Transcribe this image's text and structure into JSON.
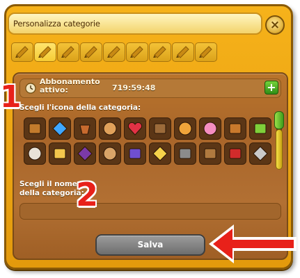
{
  "dialog": {
    "title": "Personalizza categorie",
    "close_label": "×"
  },
  "category_slots": {
    "count": 9,
    "selected_index": 1,
    "icon": "pencil-icon"
  },
  "subscription": {
    "label": "Abbonamento\nattivo:",
    "time_remaining": "719:59:48",
    "add_label": "+"
  },
  "annotations": {
    "step1": "1",
    "step2": "2"
  },
  "icon_section": {
    "label": "Scegli l'icona della categoria:",
    "icons": [
      "wooden-crate-icon",
      "blue-diamond-icon",
      "flower-pot-icon",
      "pastry-icon",
      "heart-lock-icon",
      "grinder-icon",
      "candy-icon",
      "cupcake-icon",
      "backpack-icon",
      "battery-icon",
      "sheep-icon",
      "jam-jar-icon",
      "witch-hat-icon",
      "paint-palette-icon",
      "gift-box-icon",
      "cheese-icon",
      "hammer-icon",
      "wooden-box-icon",
      "red-tube-icon",
      "trowel-icon"
    ]
  },
  "name_section": {
    "label": "Scegli il nome\ndella categoria:",
    "value": ""
  },
  "save_button": {
    "label": "Salva"
  }
}
